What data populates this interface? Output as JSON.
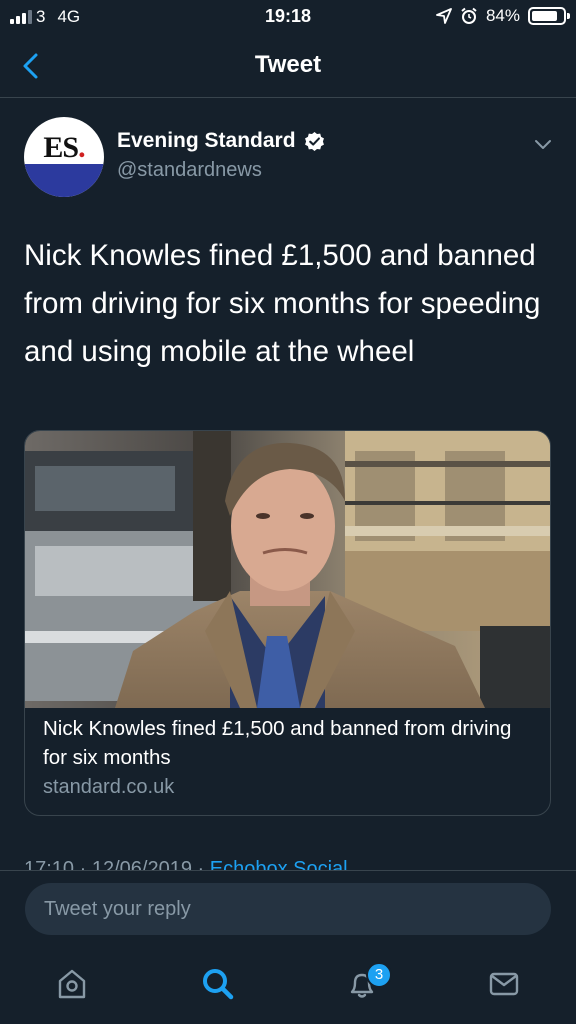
{
  "status_bar": {
    "carrier": "3",
    "network": "4G",
    "time": "19:18",
    "battery": "84%",
    "battery_level": 0.84
  },
  "header": {
    "title": "Tweet"
  },
  "author": {
    "avatar_text": "ES",
    "avatar_dot": ".",
    "name": "Evening Standard",
    "handle": "@standardnews",
    "verified": true
  },
  "tweet": {
    "text": "Nick Knowles fined £1,500 and banned from driving for six months for speeding and using mobile at the wheel"
  },
  "card": {
    "title": "Nick Knowles fined £1,500 and banned from driving for six months",
    "domain": "standard.co.uk"
  },
  "meta": {
    "time": "17:10",
    "separator": " · ",
    "date": "12/06/2019",
    "separator2": " · ",
    "source": "Echobox Social"
  },
  "reply": {
    "placeholder": "Tweet your reply"
  },
  "tab_bar": {
    "notifications_count": "3"
  },
  "colors": {
    "background": "#15202b",
    "accent": "#1da1f2",
    "secondary_text": "#8899a6",
    "border": "#38444d"
  }
}
